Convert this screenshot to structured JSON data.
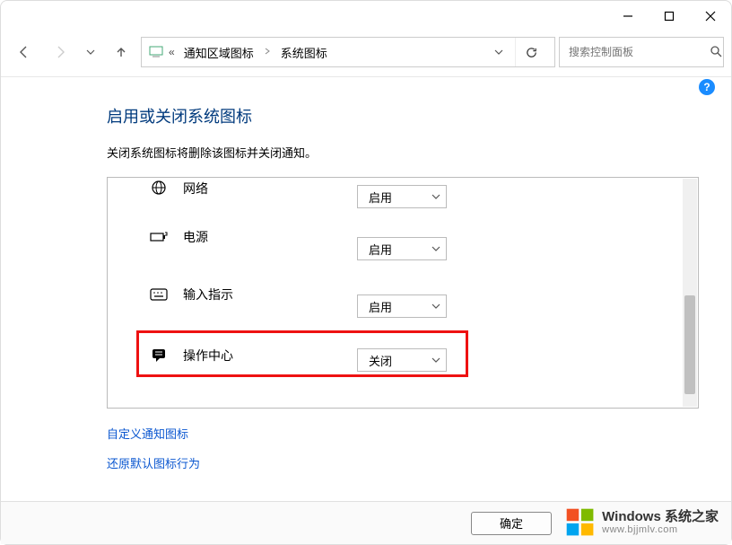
{
  "window": {
    "minimize_tip": "最小化",
    "maximize_tip": "最大化",
    "close_tip": "关闭"
  },
  "nav": {
    "back_tip": "后退",
    "forward_tip": "前进",
    "recent_tip": "最近",
    "up_tip": "上一级"
  },
  "address": {
    "prefix_glyph": "«",
    "crumb1": "通知区域图标",
    "crumb2": "系统图标",
    "refresh_tip": "刷新"
  },
  "search": {
    "placeholder": "搜索控制面板"
  },
  "help": {
    "label": "?"
  },
  "page": {
    "title": "启用或关闭系统图标",
    "desc": "关闭系统图标将删除该图标并关闭通知。"
  },
  "options": {
    "enable": "启用",
    "disable": "关闭"
  },
  "rows": [
    {
      "icon": "network-icon",
      "label": "网络",
      "value": "启用"
    },
    {
      "icon": "power-icon",
      "label": "电源",
      "value": "启用"
    },
    {
      "icon": "ime-icon",
      "label": "输入指示",
      "value": "启用"
    },
    {
      "icon": "action-center-icon",
      "label": "操作中心",
      "value": "关闭"
    }
  ],
  "links": {
    "customize": "自定义通知图标",
    "restore": "还原默认图标行为"
  },
  "buttons": {
    "ok": "确定"
  },
  "watermark": {
    "brand_win": "Windows",
    "brand_suffix": " 系统之家",
    "url": "www.bjjmlv.com"
  }
}
